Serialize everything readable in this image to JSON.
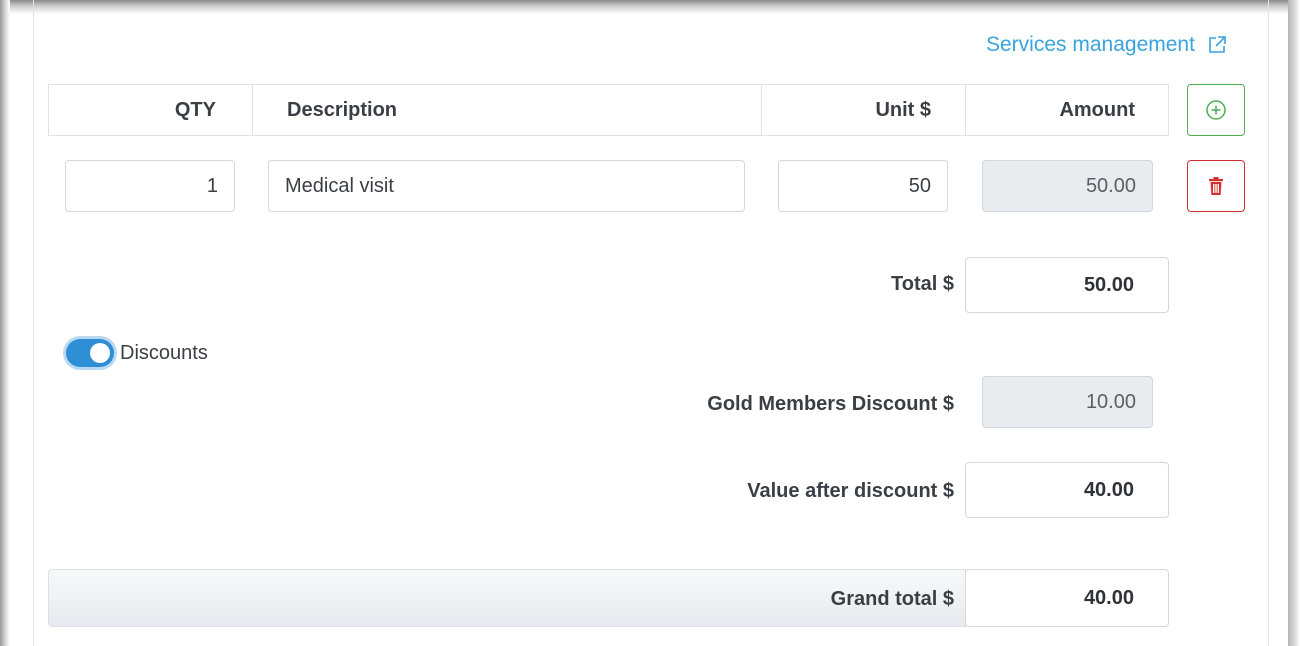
{
  "services_link": {
    "label": "Services management",
    "icon": "external-link-icon",
    "color": "#3aa3de"
  },
  "table": {
    "headers": {
      "qty": "QTY",
      "description": "Description",
      "unit": "Unit $",
      "amount": "Amount"
    },
    "add_icon": "plus-circle-icon",
    "delete_icon": "trash-icon",
    "rows": [
      {
        "qty": "1",
        "description": "Medical visit",
        "unit": "50",
        "amount": "50.00"
      }
    ]
  },
  "totals": {
    "total_label": "Total $",
    "total_value": "50.00",
    "discounts_label": "Discounts",
    "discounts_enabled": true,
    "gold_discount_label": "Gold Members Discount $",
    "gold_discount_value": "10.00",
    "after_discount_label": "Value after discount $",
    "after_discount_value": "40.00",
    "grand_total_label": "Grand total $",
    "grand_total_value": "40.00"
  },
  "colors": {
    "add_button": "#4caf50",
    "delete_button": "#d32f2f",
    "toggle_on": "#2e8fd6"
  }
}
